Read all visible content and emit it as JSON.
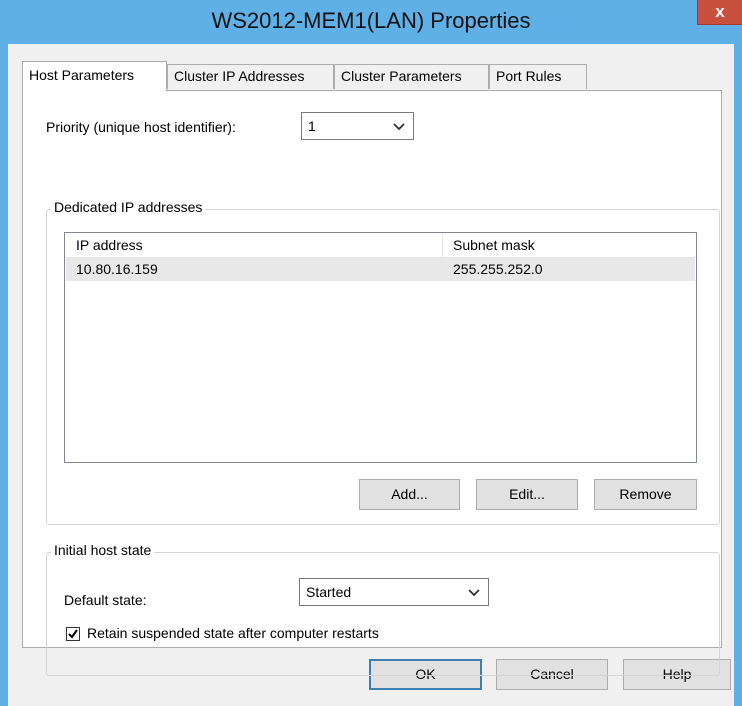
{
  "window": {
    "title": "WS2012-MEM1(LAN) Properties",
    "close_glyph": "x"
  },
  "tabs": [
    {
      "label": "Host Parameters",
      "active": true
    },
    {
      "label": "Cluster IP Addresses",
      "active": false
    },
    {
      "label": "Cluster Parameters",
      "active": false
    },
    {
      "label": "Port Rules",
      "active": false
    }
  ],
  "host_params": {
    "priority_label": "Priority (unique host identifier):",
    "priority_value": "1",
    "dedicated_group_label": "Dedicated IP addresses",
    "ip_table": {
      "columns": [
        "IP address",
        "Subnet mask"
      ],
      "rows": [
        [
          "10.80.16.159",
          "255.255.252.0"
        ]
      ]
    },
    "buttons": {
      "add": "Add...",
      "edit": "Edit...",
      "remove": "Remove"
    },
    "initial_state_group_label": "Initial host state",
    "default_state_label": "Default state:",
    "default_state_value": "Started",
    "retain_label": "Retain suspended state after computer restarts",
    "retain_checked": true
  },
  "footer": {
    "ok": "OK",
    "cancel": "Cancel",
    "help": "Help"
  },
  "colors": {
    "titlebar": "#5fb0e6",
    "close_button": "#c94f3f",
    "default_button_border": "#3c7fb1"
  },
  "icons": {
    "chevron": "chevron-down-icon",
    "checkmark": "checkmark-icon"
  }
}
